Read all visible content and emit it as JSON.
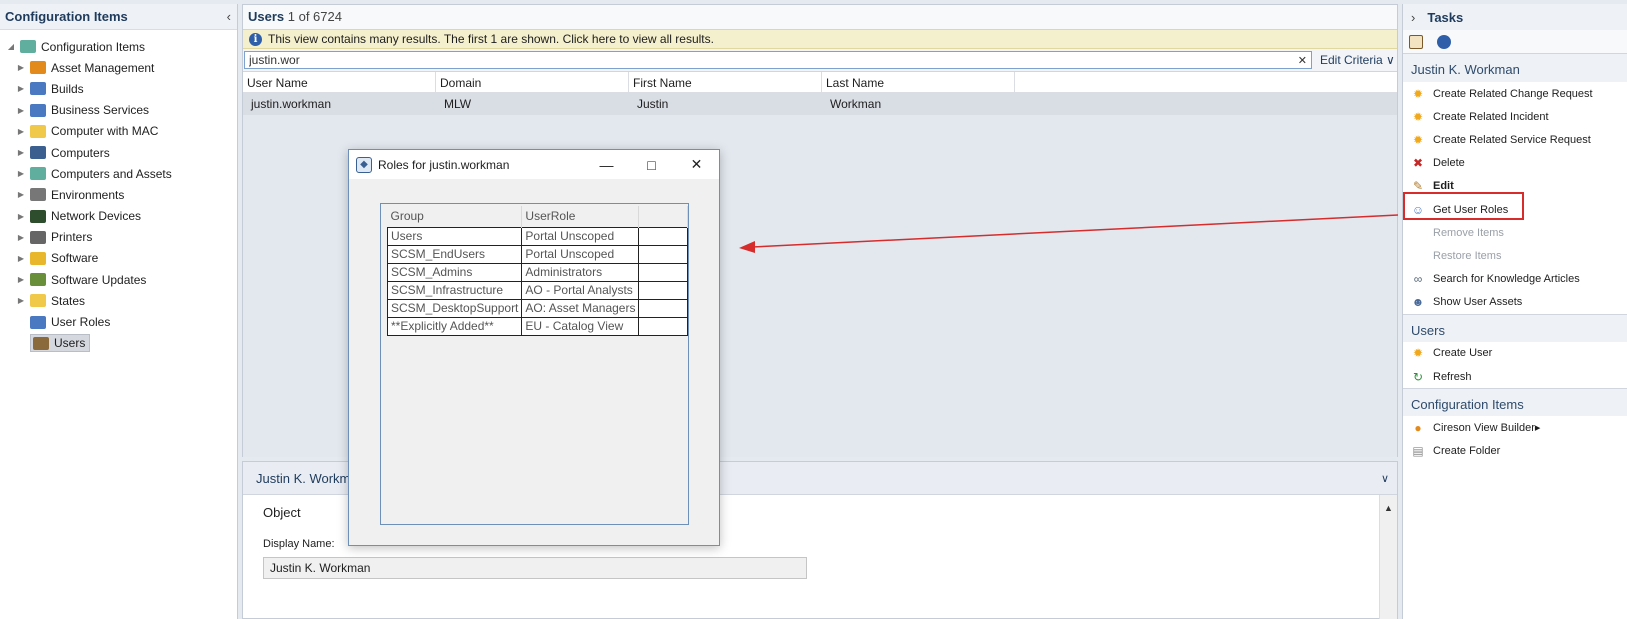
{
  "left_pane": {
    "title": "Configuration Items",
    "root": "Configuration Items",
    "items": [
      {
        "label": "Asset Management",
        "icon": "asset-management-icon",
        "color": "#e38a1c"
      },
      {
        "label": "Builds",
        "icon": "builds-icon",
        "color": "#4a79c1"
      },
      {
        "label": "Business Services",
        "icon": "business-services-icon",
        "color": "#4a79c1"
      },
      {
        "label": "Computer with MAC",
        "icon": "folder-icon",
        "color": "#f0c94a"
      },
      {
        "label": "Computers",
        "icon": "computer-icon",
        "color": "#3b5f8f"
      },
      {
        "label": "Computers and Assets",
        "icon": "view-icon",
        "color": "#5fae9e"
      },
      {
        "label": "Environments",
        "icon": "environments-icon",
        "color": "#777777"
      },
      {
        "label": "Network Devices",
        "icon": "network-device-icon",
        "color": "#2d4d2d"
      },
      {
        "label": "Printers",
        "icon": "printer-icon",
        "color": "#666666"
      },
      {
        "label": "Software",
        "icon": "software-icon",
        "color": "#e9b72c"
      },
      {
        "label": "Software Updates",
        "icon": "software-updates-icon",
        "color": "#6a8f3b"
      },
      {
        "label": "States",
        "icon": "folder-icon",
        "color": "#f0c94a"
      },
      {
        "label": "User Roles",
        "icon": "user-roles-icon",
        "color": "#4a79c1"
      },
      {
        "label": "Users",
        "icon": "users-icon",
        "color": "#8a6a3b"
      }
    ]
  },
  "center": {
    "title": "Users",
    "count": "1 of 6724",
    "info": "This view contains many results. The first 1 are shown. Click here to view all results.",
    "search_value": "justin.wor",
    "edit_criteria": "Edit Criteria",
    "columns": [
      "User Name",
      "Domain",
      "First Name",
      "Last Name"
    ],
    "rows": [
      [
        "justin.workman",
        "MLW",
        "Justin",
        "Workman"
      ]
    ]
  },
  "detail": {
    "title": "Justin K. Workman",
    "object_label": "Object",
    "display_name_label": "Display Name:",
    "display_name_value": "Justin K. Workman"
  },
  "dialog": {
    "title": "Roles for justin.workman",
    "columns": [
      "Group",
      "UserRole"
    ],
    "rows": [
      [
        "Users",
        "Portal Unscoped"
      ],
      [
        "SCSM_EndUsers",
        "Portal Unscoped"
      ],
      [
        "SCSM_Admins",
        "Administrators"
      ],
      [
        "SCSM_Infrastructure",
        "AO - Portal Analysts"
      ],
      [
        "SCSM_DesktopSupport",
        "AO: Asset Managers"
      ],
      [
        "**Explicitly Added**",
        "EU - Catalog View"
      ]
    ]
  },
  "tasks": {
    "header": "Tasks",
    "section_user": "Justin K. Workman",
    "user_tasks": [
      {
        "label": "Create Related Change Request",
        "icon": "sunburst-icon",
        "state": "enabled"
      },
      {
        "label": "Create Related Incident",
        "icon": "sunburst-icon",
        "state": "enabled"
      },
      {
        "label": "Create Related Service Request",
        "icon": "sunburst-icon",
        "state": "enabled"
      },
      {
        "label": "Delete",
        "icon": "delete-icon",
        "state": "enabled"
      },
      {
        "label": "Edit",
        "icon": "pencil-icon",
        "state": "bold"
      },
      {
        "label": "Get User Roles",
        "icon": "user-roles-icon",
        "state": "enabled"
      },
      {
        "label": "Remove Items",
        "icon": "",
        "state": "disabled"
      },
      {
        "label": "Restore Items",
        "icon": "",
        "state": "disabled"
      },
      {
        "label": "Search for Knowledge Articles",
        "icon": "link-icon",
        "state": "enabled"
      },
      {
        "label": "Show User Assets",
        "icon": "user-icon",
        "state": "enabled"
      }
    ],
    "section_users": "Users",
    "users_tasks": [
      {
        "label": "Create User",
        "icon": "sunburst-icon",
        "state": "enabled"
      },
      {
        "label": "Refresh",
        "icon": "refresh-icon",
        "state": "enabled"
      }
    ],
    "section_ci": "Configuration Items",
    "ci_tasks": [
      {
        "label": "Cireson View Builder",
        "icon": "view-builder-icon",
        "state": "enabled"
      },
      {
        "label": "Create Folder",
        "icon": "folder-icon",
        "state": "enabled"
      }
    ]
  },
  "colors": {
    "accent": "#1f3b5c",
    "highlight": "#d62c2c",
    "info_bar": "#f4efcc",
    "selected_row": "#d9dde4"
  }
}
